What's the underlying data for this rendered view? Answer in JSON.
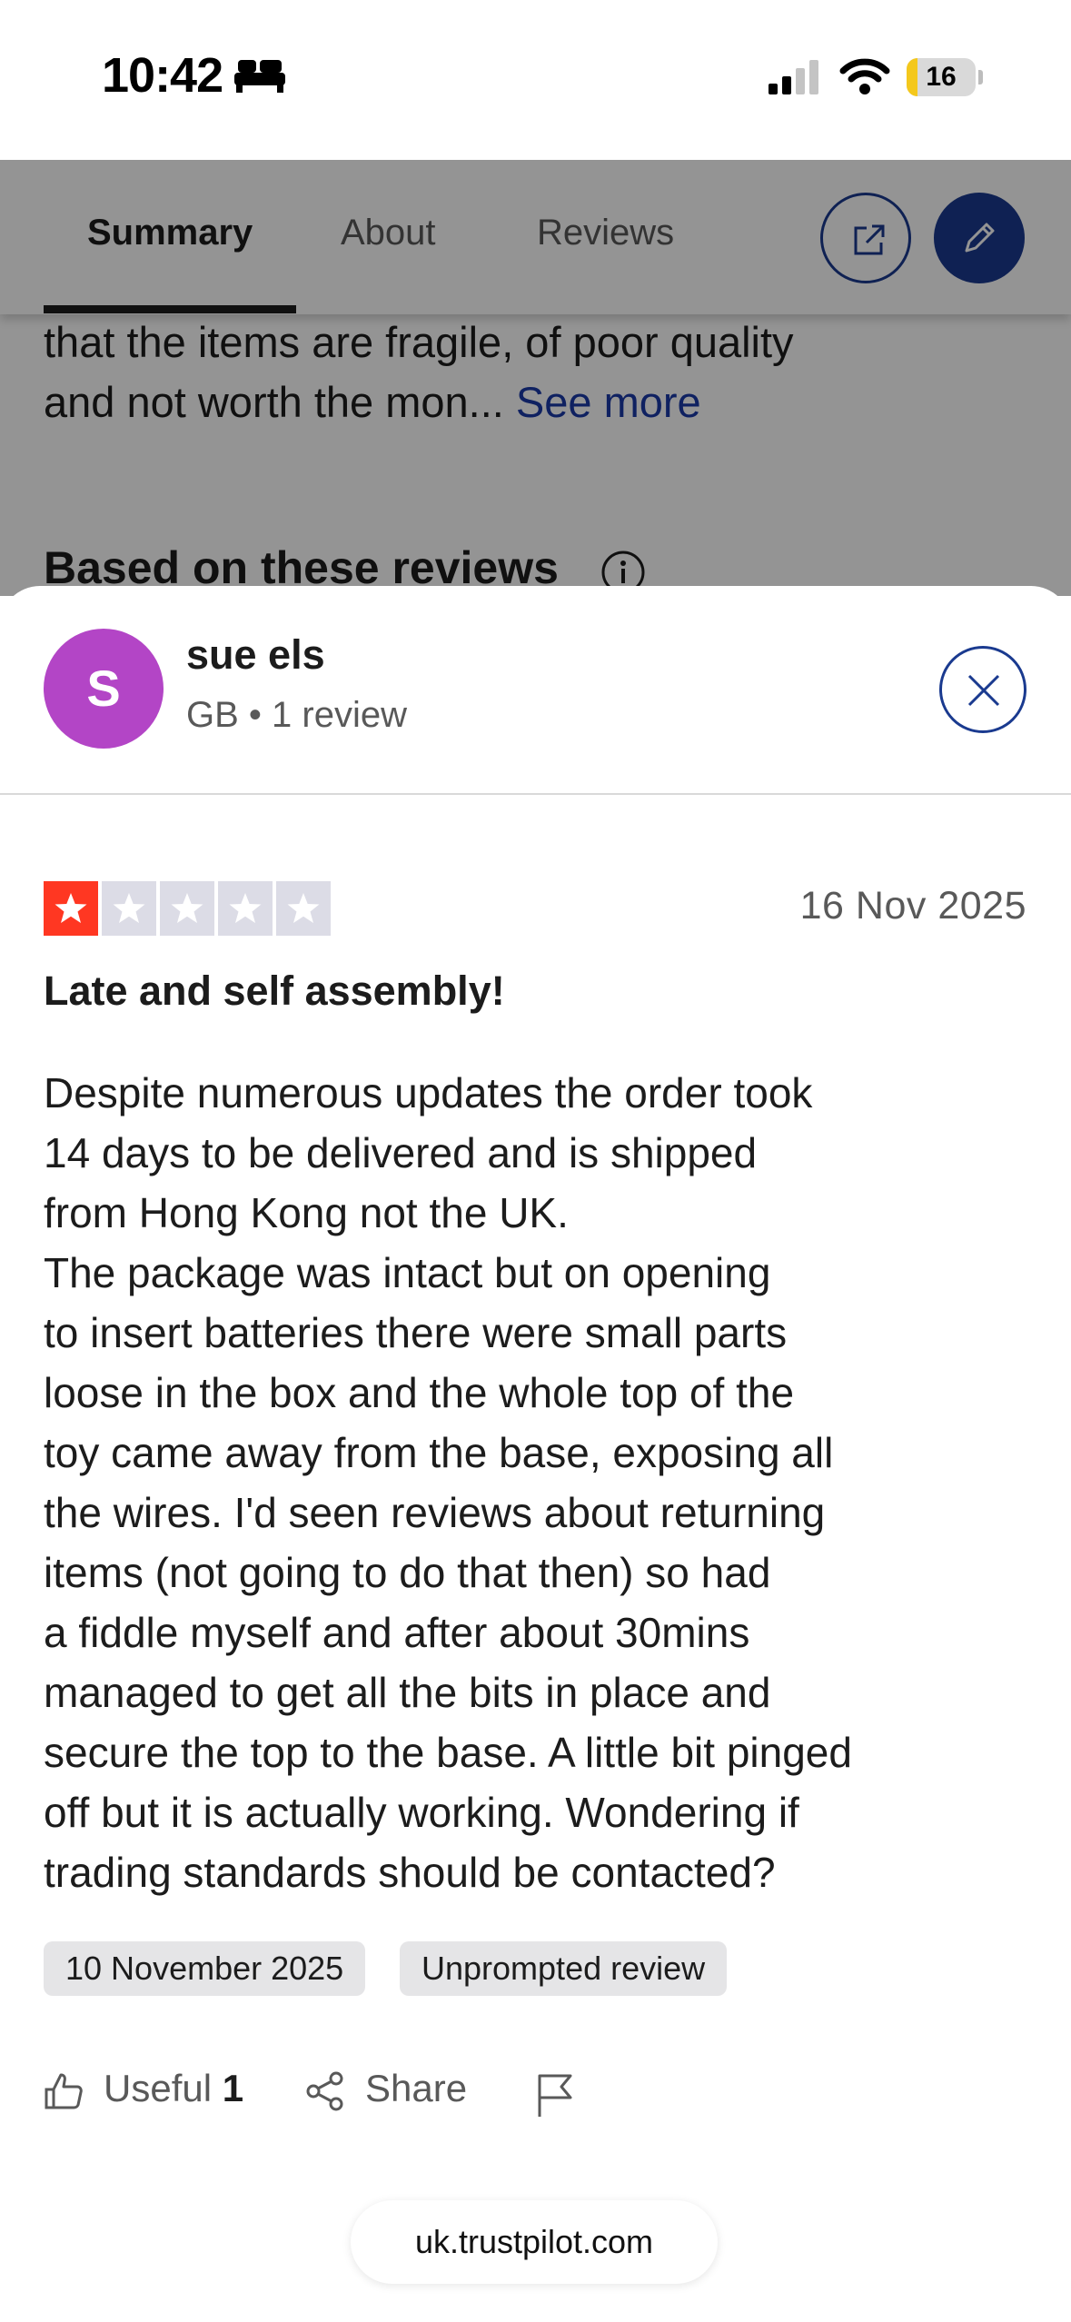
{
  "status_bar": {
    "time": "10:42",
    "battery_level": "16",
    "battery_fraction": 0.16,
    "icons": [
      "bed-icon",
      "signal-icon",
      "wifi-icon",
      "battery-icon"
    ]
  },
  "tabs": {
    "items": [
      {
        "label": "Summary",
        "active": true
      },
      {
        "label": "About",
        "active": false
      },
      {
        "label": "Reviews",
        "active": false
      }
    ],
    "buttons": [
      "external-link-icon",
      "pencil-icon"
    ]
  },
  "background": {
    "text_line1": "that the items are fragile, of poor quality",
    "text_line2": "and not worth the mon...",
    "see_more": "See more",
    "section_title": "Based on these reviews",
    "info_icon": "info-icon"
  },
  "reviewer": {
    "initial": "S",
    "name": "sue els",
    "meta": "GB • 1 review",
    "avatar_color": "#b345c6"
  },
  "review": {
    "rating": 1,
    "rating_max": 5,
    "date": "16 Nov 2025",
    "title": "Late and self assembly!",
    "body": "Despite numerous updates the order took\n14 days to be delivered and is shipped\nfrom Hong Kong not the UK.\nThe package was intact but on opening\nto insert batteries there were small parts\nloose in the box and the whole top of the\ntoy came away from the base, exposing all\nthe wires. I'd seen reviews about returning\nitems (not going to do that then) so had\na fiddle myself and after about 30mins\nmanaged to get all the bits in place and\nsecure the top to the base. A little bit pinged\noff but it is actually working. Wondering if\ntrading standards should be contacted?",
    "experience_date": "10 November 2025",
    "review_type": "Unprompted review",
    "useful_label": "Useful",
    "useful_count": "1",
    "share_label": "Share"
  },
  "browser": {
    "url": "uk.trustpilot.com"
  },
  "colors": {
    "brand_blue": "#1a3a8f",
    "star_red": "#ff3722",
    "star_empty": "#dcdce6"
  }
}
